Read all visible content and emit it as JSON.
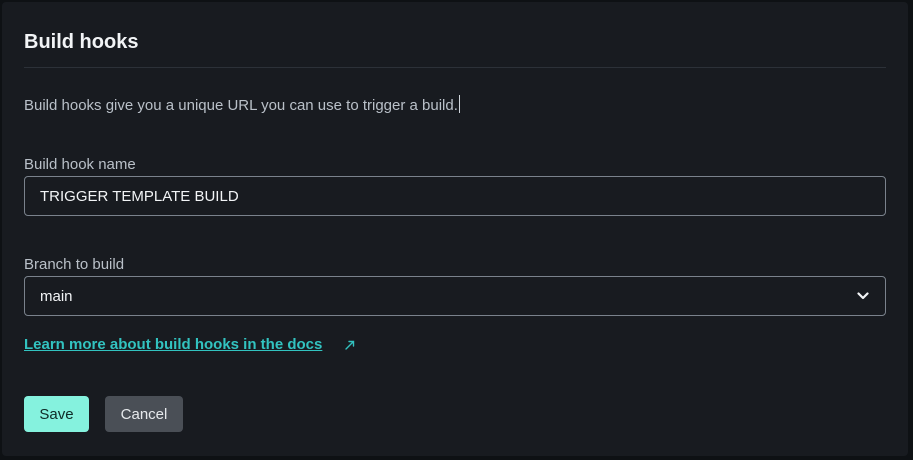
{
  "card": {
    "title": "Build hooks",
    "description": "Build hooks give you a unique URL you can use to trigger a build."
  },
  "form": {
    "name_label": "Build hook name",
    "name_value": "TRIGGER TEMPLATE BUILD",
    "branch_label": "Branch to build",
    "branch_value": "main",
    "docs_link": "Learn more about build hooks in the docs"
  },
  "actions": {
    "save_label": "Save",
    "cancel_label": "Cancel"
  },
  "icons": {
    "select": "chevron-down-icon",
    "link": "external-link-icon"
  },
  "colors": {
    "accent": "#32c3c0",
    "primary_button": "#85f2de",
    "secondary_button": "#4a4f56",
    "background": "#181b20"
  }
}
